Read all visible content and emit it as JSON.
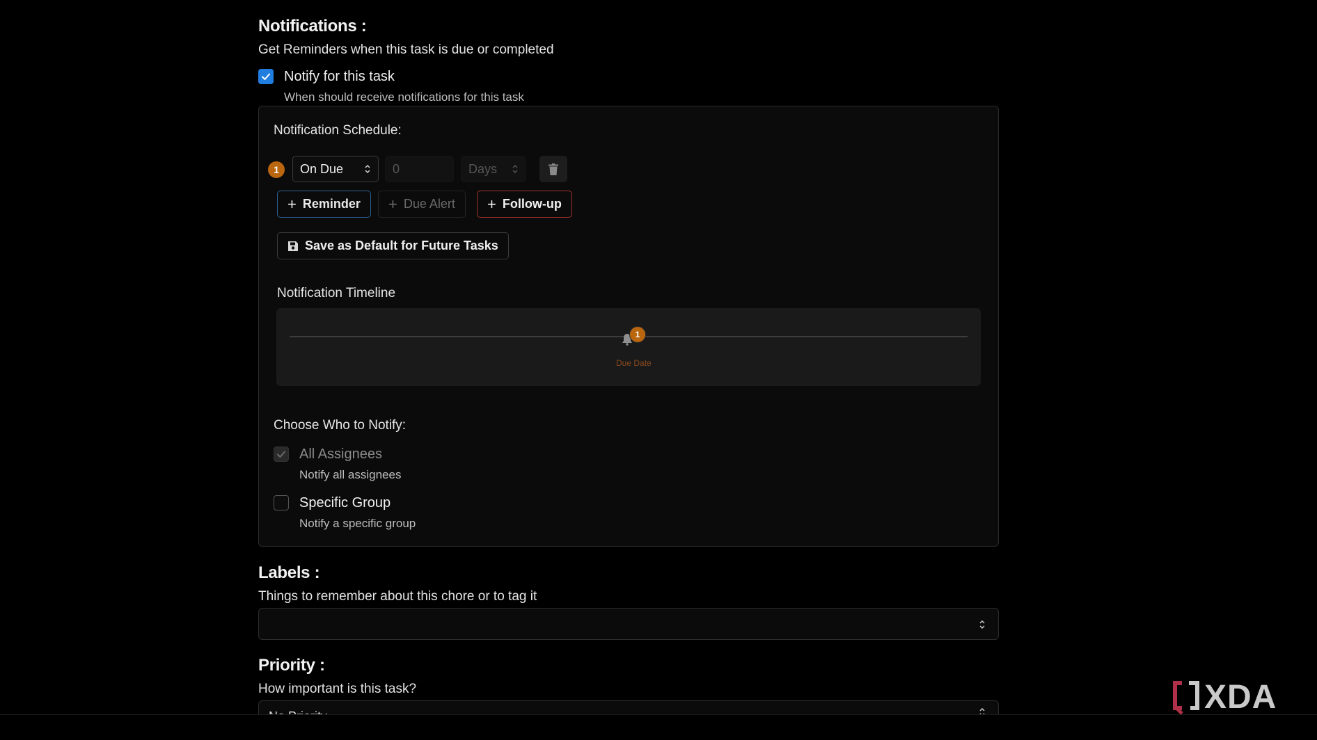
{
  "notifications": {
    "title": "Notifications :",
    "subtitle": "Get Reminders when this task is due or completed",
    "notify_checkbox": {
      "label": "Notify for this task",
      "checked": true
    },
    "notify_helper": "When should receive notifications for this task",
    "schedule": {
      "heading": "Notification Schedule:",
      "row": {
        "index": "1",
        "trigger_value": "On Due",
        "offset_value": "0",
        "unit_value": "Days"
      },
      "buttons": {
        "reminder": "Reminder",
        "due_alert": "Due Alert",
        "follow_up": "Follow-up",
        "save_default": "Save as Default for Future Tasks"
      }
    },
    "timeline": {
      "heading": "Notification Timeline",
      "marker_count": "1",
      "marker_label": "Due Date"
    },
    "recipients": {
      "heading": "Choose Who to Notify:",
      "all_assignees": {
        "label": "All Assignees",
        "helper": "Notify all assignees",
        "checked": true,
        "disabled": true
      },
      "specific_group": {
        "label": "Specific Group",
        "helper": "Notify a specific group",
        "checked": false
      }
    }
  },
  "labels": {
    "title": "Labels :",
    "subtitle": "Things to remember about this chore or to tag it",
    "value": ""
  },
  "priority": {
    "title": "Priority :",
    "subtitle": "How important is this task?",
    "value": "No Priority"
  },
  "watermark": {
    "brand": "XDA"
  },
  "colors": {
    "background": "#000000",
    "accent_blue": "#1f7ee0",
    "badge_orange": "#b9660f",
    "followup_red": "#a33030"
  }
}
